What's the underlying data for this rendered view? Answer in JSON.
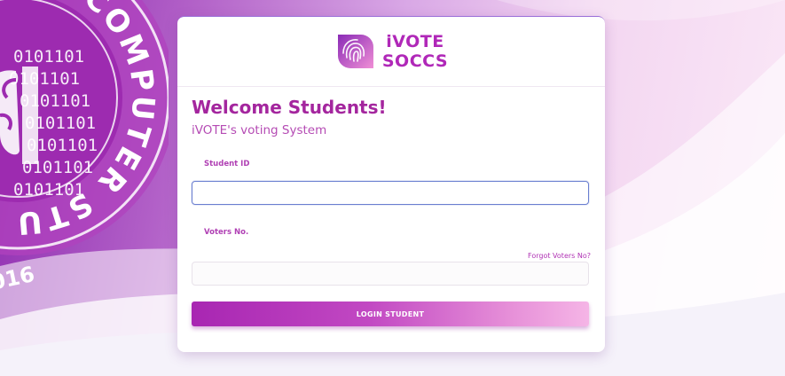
{
  "background": {
    "seal_text": "COLLEGE OF COMPUTER STUDIES",
    "seal_year_fragment": "016",
    "binary_text": "0101101"
  },
  "app": {
    "logo_line1": "iVOTE",
    "logo_line2": "SOCCS",
    "logo_icon": "fingerprint-icon"
  },
  "form": {
    "heading": "Welcome Students!",
    "subheading": "iVOTE's voting System",
    "student_id_label": "Student ID",
    "student_id_value": "",
    "voters_no_label": "Voters No.",
    "voters_no_value": "",
    "forgot_link": "Forgot Voters No?",
    "login_button": "LOGIN STUDENT"
  },
  "colors": {
    "accent": "#a4269e",
    "button_start": "#a826b2",
    "button_end": "#f5b5e6",
    "focus_border": "#6a7fd0"
  }
}
